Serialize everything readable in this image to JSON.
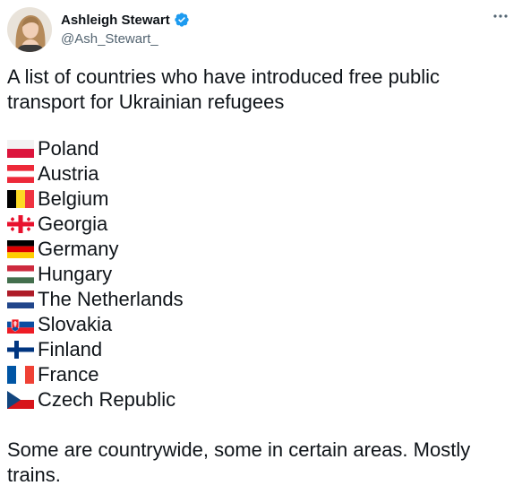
{
  "author": {
    "display_name": "Ashleigh Stewart",
    "handle": "@Ash_Stewart_",
    "verified_icon": "verified-badge-icon",
    "avatar_icon": "avatar"
  },
  "menu": {
    "more_icon": "more-options-icon",
    "more_label": "···"
  },
  "tweet": {
    "intro": "A list of countries who have introduced free public transport for Ukrainian refugees",
    "countries": [
      {
        "name": "Poland",
        "flag": "poland-flag-icon"
      },
      {
        "name": "Austria",
        "flag": "austria-flag-icon"
      },
      {
        "name": "Belgium",
        "flag": "belgium-flag-icon"
      },
      {
        "name": "Georgia",
        "flag": "georgia-flag-icon"
      },
      {
        "name": "Germany",
        "flag": "germany-flag-icon"
      },
      {
        "name": "Hungary",
        "flag": "hungary-flag-icon"
      },
      {
        "name": "The Netherlands",
        "flag": "netherlands-flag-icon"
      },
      {
        "name": "Slovakia",
        "flag": "slovakia-flag-icon"
      },
      {
        "name": "Finland",
        "flag": "finland-flag-icon"
      },
      {
        "name": "France",
        "flag": "france-flag-icon"
      },
      {
        "name": "Czech Republic",
        "flag": "czech-republic-flag-icon"
      }
    ],
    "outro": "Some are countrywide, some in certain areas. Mostly trains."
  },
  "colors": {
    "verified_blue": "#1d9bf0",
    "text_primary": "#0f1419",
    "text_secondary": "#536471"
  }
}
